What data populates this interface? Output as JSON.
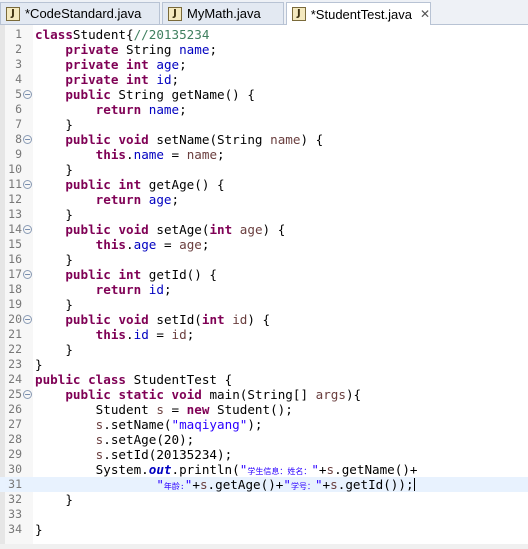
{
  "tabs": [
    {
      "label": "*CodeStandard.java",
      "active": false
    },
    {
      "label": "MyMath.java",
      "active": false
    },
    {
      "label": "*StudentTest.java",
      "active": true
    }
  ],
  "editor": {
    "current_line": 31,
    "lines": [
      {
        "n": "1",
        "fold": false,
        "tokens": [
          [
            "kw",
            "class"
          ],
          [
            "",
            "Student{"
          ],
          [
            "cm",
            "//20135234"
          ]
        ]
      },
      {
        "n": "2",
        "fold": false,
        "tokens": [
          [
            "",
            "    "
          ],
          [
            "kw",
            "private"
          ],
          [
            "",
            " String "
          ],
          [
            "fd",
            "name"
          ],
          [
            "",
            ";"
          ]
        ]
      },
      {
        "n": "3",
        "fold": false,
        "tokens": [
          [
            "",
            "    "
          ],
          [
            "kw",
            "private"
          ],
          [
            "",
            " "
          ],
          [
            "kw",
            "int"
          ],
          [
            "",
            " "
          ],
          [
            "fd",
            "age"
          ],
          [
            "",
            ";"
          ]
        ]
      },
      {
        "n": "4",
        "fold": false,
        "tokens": [
          [
            "",
            "    "
          ],
          [
            "kw",
            "private"
          ],
          [
            "",
            " "
          ],
          [
            "kw",
            "int"
          ],
          [
            "",
            " "
          ],
          [
            "fd",
            "id"
          ],
          [
            "",
            ";"
          ]
        ]
      },
      {
        "n": "5",
        "fold": true,
        "tokens": [
          [
            "",
            "    "
          ],
          [
            "kw",
            "public"
          ],
          [
            "",
            " String getName() {"
          ]
        ]
      },
      {
        "n": "6",
        "fold": false,
        "tokens": [
          [
            "",
            "        "
          ],
          [
            "kw",
            "return"
          ],
          [
            "",
            " "
          ],
          [
            "fd",
            "name"
          ],
          [
            "",
            ";"
          ]
        ]
      },
      {
        "n": "7",
        "fold": false,
        "tokens": [
          [
            "",
            "    }"
          ]
        ]
      },
      {
        "n": "8",
        "fold": true,
        "tokens": [
          [
            "",
            "    "
          ],
          [
            "kw",
            "public"
          ],
          [
            "",
            " "
          ],
          [
            "kw",
            "void"
          ],
          [
            "",
            " setName(String "
          ],
          [
            "ar",
            "name"
          ],
          [
            "",
            ") {"
          ]
        ]
      },
      {
        "n": "9",
        "fold": false,
        "tokens": [
          [
            "",
            "        "
          ],
          [
            "kw",
            "this"
          ],
          [
            "",
            "."
          ],
          [
            "fd",
            "name"
          ],
          [
            "",
            " = "
          ],
          [
            "ar",
            "name"
          ],
          [
            "",
            ";"
          ]
        ]
      },
      {
        "n": "10",
        "fold": false,
        "tokens": [
          [
            "",
            "    }"
          ]
        ]
      },
      {
        "n": "11",
        "fold": true,
        "tokens": [
          [
            "",
            "    "
          ],
          [
            "kw",
            "public"
          ],
          [
            "",
            " "
          ],
          [
            "kw",
            "int"
          ],
          [
            "",
            " getAge() {"
          ]
        ]
      },
      {
        "n": "12",
        "fold": false,
        "tokens": [
          [
            "",
            "        "
          ],
          [
            "kw",
            "return"
          ],
          [
            "",
            " "
          ],
          [
            "fd",
            "age"
          ],
          [
            "",
            ";"
          ]
        ]
      },
      {
        "n": "13",
        "fold": false,
        "tokens": [
          [
            "",
            "    }"
          ]
        ]
      },
      {
        "n": "14",
        "fold": true,
        "tokens": [
          [
            "",
            "    "
          ],
          [
            "kw",
            "public"
          ],
          [
            "",
            " "
          ],
          [
            "kw",
            "void"
          ],
          [
            "",
            " setAge("
          ],
          [
            "kw",
            "int"
          ],
          [
            "",
            " "
          ],
          [
            "ar",
            "age"
          ],
          [
            "",
            ") {"
          ]
        ]
      },
      {
        "n": "15",
        "fold": false,
        "tokens": [
          [
            "",
            "        "
          ],
          [
            "kw",
            "this"
          ],
          [
            "",
            "."
          ],
          [
            "fd",
            "age"
          ],
          [
            "",
            " = "
          ],
          [
            "ar",
            "age"
          ],
          [
            "",
            ";"
          ]
        ]
      },
      {
        "n": "16",
        "fold": false,
        "tokens": [
          [
            "",
            "    }"
          ]
        ]
      },
      {
        "n": "17",
        "fold": true,
        "tokens": [
          [
            "",
            "    "
          ],
          [
            "kw",
            "public"
          ],
          [
            "",
            " "
          ],
          [
            "kw",
            "int"
          ],
          [
            "",
            " getId() {"
          ]
        ]
      },
      {
        "n": "18",
        "fold": false,
        "tokens": [
          [
            "",
            "        "
          ],
          [
            "kw",
            "return"
          ],
          [
            "",
            " "
          ],
          [
            "fd",
            "id"
          ],
          [
            "",
            ";"
          ]
        ]
      },
      {
        "n": "19",
        "fold": false,
        "tokens": [
          [
            "",
            "    }"
          ]
        ]
      },
      {
        "n": "20",
        "fold": true,
        "tokens": [
          [
            "",
            "    "
          ],
          [
            "kw",
            "public"
          ],
          [
            "",
            " "
          ],
          [
            "kw",
            "void"
          ],
          [
            "",
            " setId("
          ],
          [
            "kw",
            "int"
          ],
          [
            "",
            " "
          ],
          [
            "ar",
            "id"
          ],
          [
            "",
            ") {"
          ]
        ]
      },
      {
        "n": "21",
        "fold": false,
        "tokens": [
          [
            "",
            "        "
          ],
          [
            "kw",
            "this"
          ],
          [
            "",
            "."
          ],
          [
            "fd",
            "id"
          ],
          [
            "",
            " = "
          ],
          [
            "ar",
            "id"
          ],
          [
            "",
            ";"
          ]
        ]
      },
      {
        "n": "22",
        "fold": false,
        "tokens": [
          [
            "",
            "    }"
          ]
        ]
      },
      {
        "n": "23",
        "fold": false,
        "tokens": [
          [
            "",
            "}"
          ]
        ]
      },
      {
        "n": "24",
        "fold": false,
        "tokens": [
          [
            "kw",
            "public"
          ],
          [
            "",
            " "
          ],
          [
            "kw",
            "class"
          ],
          [
            "",
            " StudentTest {"
          ]
        ]
      },
      {
        "n": "25",
        "fold": true,
        "tokens": [
          [
            "",
            "    "
          ],
          [
            "kw",
            "public"
          ],
          [
            "",
            " "
          ],
          [
            "kw",
            "static"
          ],
          [
            "",
            " "
          ],
          [
            "kw",
            "void"
          ],
          [
            "",
            " main(String[] "
          ],
          [
            "ar",
            "args"
          ],
          [
            "",
            "){"
          ]
        ]
      },
      {
        "n": "26",
        "fold": false,
        "tokens": [
          [
            "",
            "        Student "
          ],
          [
            "ar",
            "s"
          ],
          [
            "",
            " = "
          ],
          [
            "kw",
            "new"
          ],
          [
            "",
            " Student();"
          ]
        ]
      },
      {
        "n": "27",
        "fold": false,
        "tokens": [
          [
            "",
            "        "
          ],
          [
            "ar",
            "s"
          ],
          [
            "",
            ".setName("
          ],
          [
            "st",
            "\"maqiyang\""
          ],
          [
            "",
            ");"
          ]
        ]
      },
      {
        "n": "28",
        "fold": false,
        "tokens": [
          [
            "",
            "        "
          ],
          [
            "ar",
            "s"
          ],
          [
            "",
            ".setAge(20);"
          ]
        ]
      },
      {
        "n": "29",
        "fold": false,
        "tokens": [
          [
            "",
            "        "
          ],
          [
            "ar",
            "s"
          ],
          [
            "",
            ".setId(20135234);"
          ]
        ]
      },
      {
        "n": "30",
        "fold": false,
        "tokens": [
          [
            "",
            "        System."
          ],
          [
            "sm",
            "out"
          ],
          [
            "",
            ".println("
          ],
          [
            "st",
            "\""
          ],
          [
            "stc",
            "学生信息：姓名："
          ],
          [
            "st",
            "\""
          ],
          [
            "",
            "+"
          ],
          [
            "ar",
            "s"
          ],
          [
            "",
            ".getName()+"
          ]
        ]
      },
      {
        "n": "31",
        "fold": false,
        "tokens": [
          [
            "",
            "                "
          ],
          [
            "st",
            "\""
          ],
          [
            "stc",
            "年龄:"
          ],
          [
            "st",
            "\""
          ],
          [
            "",
            "+"
          ],
          [
            "ar",
            "s"
          ],
          [
            "",
            ".getAge()+"
          ],
          [
            "st",
            "\""
          ],
          [
            "stc",
            "学号："
          ],
          [
            "st",
            "\""
          ],
          [
            "",
            "+"
          ],
          [
            "ar",
            "s"
          ],
          [
            "",
            ".getId());"
          ],
          [
            "cursor",
            ""
          ]
        ]
      },
      {
        "n": "32",
        "fold": false,
        "tokens": [
          [
            "",
            "    }"
          ]
        ]
      },
      {
        "n": "33",
        "fold": false,
        "tokens": [
          [
            "",
            ""
          ]
        ]
      },
      {
        "n": "34",
        "fold": false,
        "tokens": [
          [
            "",
            "}"
          ]
        ]
      }
    ]
  }
}
